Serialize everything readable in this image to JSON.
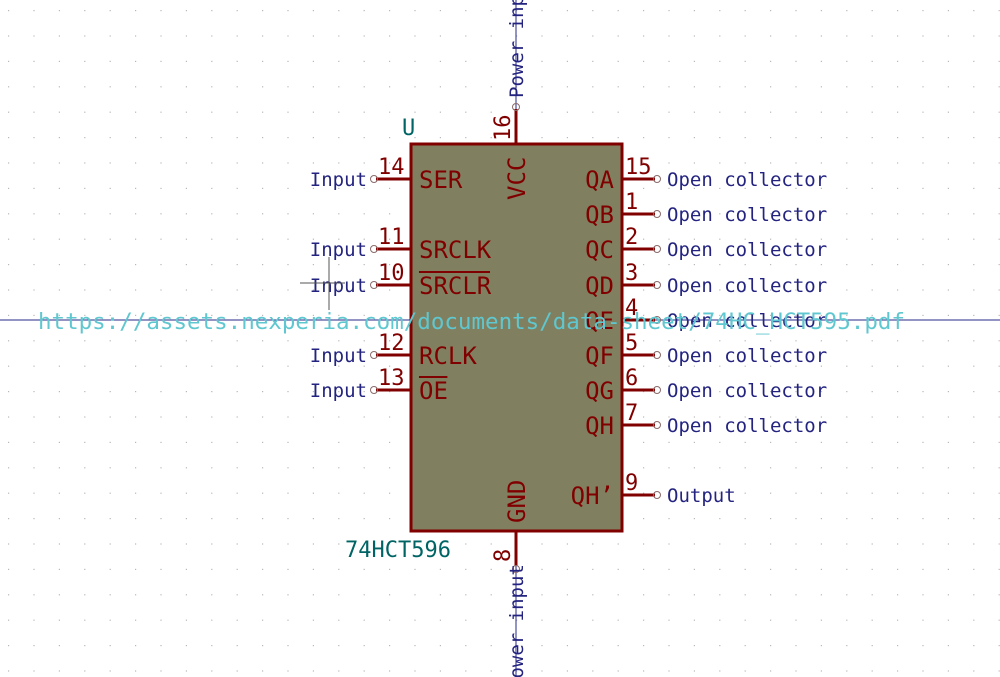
{
  "component": {
    "reference": "U",
    "value": "74HCT596",
    "datasheet": "https://assets.nexperia.com/documents/data-sheet/74HC_HCT595.pdf",
    "body_color": "#808060",
    "outline_color": "#800000",
    "field_color": "#006464",
    "pin_type_color": "#242480"
  },
  "pins_left": [
    {
      "number": "14",
      "name": "SER",
      "type": "Input",
      "overbar": false
    },
    {
      "number": "11",
      "name": "SRCLK",
      "type": "Input",
      "overbar": false
    },
    {
      "number": "10",
      "name": "SRCLR",
      "type": "Input",
      "overbar": true
    },
    {
      "number": "12",
      "name": "RCLK",
      "type": "Input",
      "overbar": false
    },
    {
      "number": "13",
      "name": "OE",
      "type": "Input",
      "overbar": true
    }
  ],
  "pins_right": [
    {
      "number": "15",
      "name": "QA",
      "type": "Open collector"
    },
    {
      "number": "1",
      "name": "QB",
      "type": "Open collector"
    },
    {
      "number": "2",
      "name": "QC",
      "type": "Open collector"
    },
    {
      "number": "3",
      "name": "QD",
      "type": "Open collector"
    },
    {
      "number": "4",
      "name": "QE",
      "type": "Open collector"
    },
    {
      "number": "5",
      "name": "QF",
      "type": "Open collector"
    },
    {
      "number": "6",
      "name": "QG",
      "type": "Open collector"
    },
    {
      "number": "7",
      "name": "QH",
      "type": "Open collector"
    },
    {
      "number": "9",
      "name": "QH’",
      "type": "Output"
    }
  ],
  "pins_top": [
    {
      "number": "16",
      "name": "VCC",
      "type": "Power input"
    }
  ],
  "pins_bottom": [
    {
      "number": "8",
      "name": "GND",
      "type": "Power input"
    }
  ]
}
